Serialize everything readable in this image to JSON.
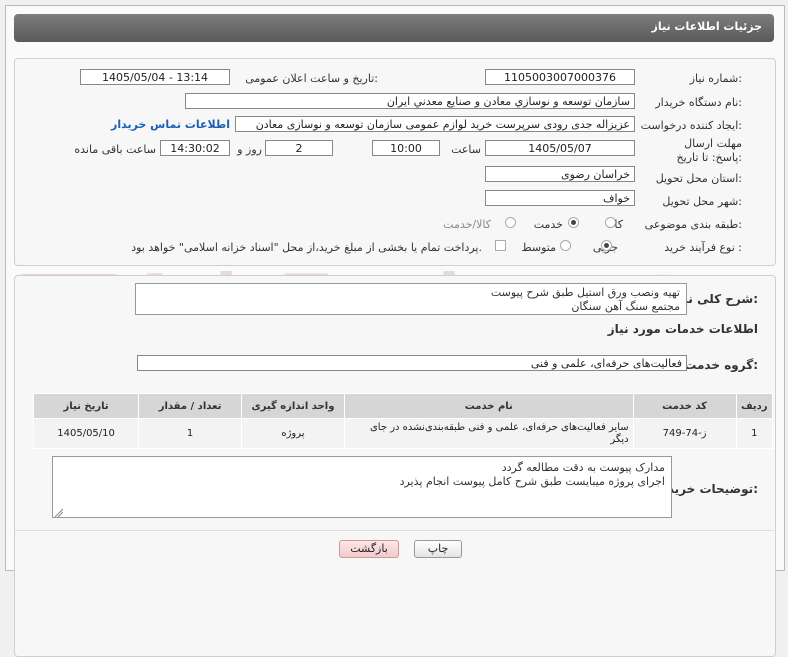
{
  "header": {
    "title": "جزئیات اطلاعات نیاز"
  },
  "watermark": "AriaTender.net",
  "fields": {
    "need_number_label": "شماره نیاز:",
    "need_number": "1105003007000376",
    "announce_label": "تاریخ و ساعت اعلان عمومی:",
    "announce_value": "1405/05/04 - 13:14",
    "buyer_org_label": "نام دستگاه خریدار:",
    "buyer_org": "سازمان توسعه و نوسازي معادن و صنايع معدني ايران",
    "creator_label": "ایجاد کننده درخواست:",
    "creator": "عزیزاله جدی رودی سرپرست خرید لوازم عمومی  سازمان توسعه و نوسازی معادن",
    "contact_link": "اطلاعات تماس خریدار",
    "deadline_label": "مهلت ارسال پاسخ: تا تاریخ:",
    "deadline_date": "1405/05/07",
    "time_label": "ساعت",
    "deadline_time": "10:00",
    "days_value": "2",
    "days_label": "روز و",
    "remaining_time": "14:30:02",
    "remaining_label": "ساعت باقی مانده",
    "province_label": "استان محل تحویل:",
    "province": "خراسان رضوی",
    "city_label": "شهر محل تحویل:",
    "city": "خواف",
    "category_label": "طبقه بندی موضوعی:",
    "category_options": [
      "کالا",
      "خدمت",
      "کالا/خدمت"
    ],
    "process_label": "نوع فرآیند خرید :",
    "process_options": [
      "جزیی",
      "متوسط"
    ],
    "payment_note": "پرداخت تمام یا بخشی از مبلغ خرید،از محل \"اسناد خزانه اسلامی\" خواهد بود."
  },
  "summary": {
    "label": "شرح کلی نیاز:",
    "line1": "تهیه ونصب ورق استیل طبق شرح پیوست",
    "line2": "مجتمع سنگ آهن سنگان"
  },
  "services": {
    "section_title": "اطلاعات خدمات مورد نیاز",
    "group_label": "گروه خدمت:",
    "group_value": "فعالیت‌های حرفه‌ای، علمی و فنی"
  },
  "table": {
    "headers": [
      "ردیف",
      "کد خدمت",
      "نام خدمت",
      "واحد اندازه گیری",
      "تعداد / مقدار",
      "تاریخ نیاز"
    ],
    "rows": [
      [
        "1",
        "ز-74-749",
        "سایر فعالیت‌های حرفه‌ای، علمی و فنی طبقه‌بندی‌نشده در جای دیگر",
        "پروژه",
        "1",
        "1405/05/10"
      ]
    ]
  },
  "buyer_notes": {
    "label": "توضیحات خریدار:",
    "line1": "مدارک پیوست به دقت مطالعه گردد",
    "line2": "اجرای پروژه میبایست طبق شرح کامل پیوست انجام پذیرد"
  },
  "buttons": {
    "print": "چاپ",
    "back": "بازگشت"
  }
}
